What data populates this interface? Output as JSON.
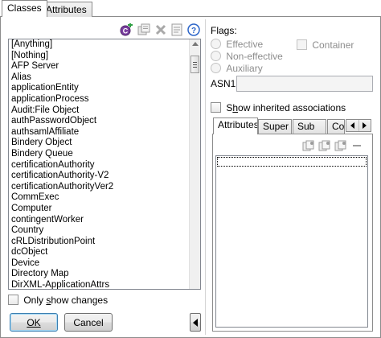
{
  "tabs": [
    {
      "label": "Classes",
      "active": true
    },
    {
      "label": "Attributes",
      "active": false
    }
  ],
  "toolbar": {
    "icons": [
      "new-class-icon",
      "properties-icon",
      "delete-icon",
      "notes-icon",
      "help-icon"
    ]
  },
  "class_list": {
    "items": [
      "[Anything]",
      "[Nothing]",
      "AFP Server",
      "Alias",
      "applicationEntity",
      "applicationProcess",
      "Audit:File Object",
      "authPasswordObject",
      "authsamlAffiliate",
      "Bindery Object",
      "Bindery Queue",
      "certificationAuthority",
      "certificationAuthority-V2",
      "certificationAuthorityVer2",
      "CommExec",
      "Computer",
      "contingentWorker",
      "Country",
      "cRLDistributionPoint",
      "dcObject",
      "Device",
      "Directory Map",
      "DirXML-ApplicationAttrs"
    ]
  },
  "only_show_changes": {
    "label_pre": "Only ",
    "label_u": "s",
    "label_post": "how changes"
  },
  "buttons": {
    "ok": "OK",
    "cancel": "Cancel"
  },
  "flags": {
    "title": "Flags:",
    "effective": "Effective",
    "non_effective": "Non-effective",
    "auxiliary": "Auxiliary",
    "container": "Container"
  },
  "asn1": {
    "label": "ASN1:",
    "value": ""
  },
  "show_inherited": {
    "label_pre": "S",
    "label_u": "h",
    "label_post": "ow inherited associations"
  },
  "inner_tabs": [
    {
      "label": "Attributes",
      "active": true
    },
    {
      "label": "Super",
      "active": false
    },
    {
      "label": "Sub",
      "active": false
    },
    {
      "label": "Co",
      "active": false
    }
  ],
  "colors": {
    "accent": "#3c7fb1",
    "focus_blue": "#2b64c8"
  }
}
